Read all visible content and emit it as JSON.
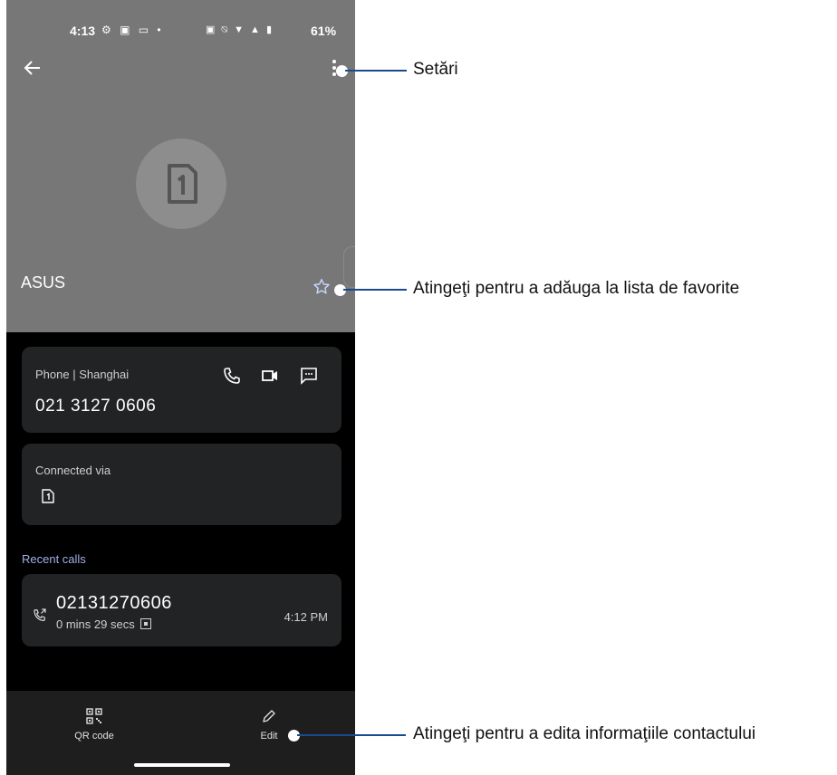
{
  "status_bar": {
    "time": "4:13",
    "left_icons": "⚙ ▣ ▭ •",
    "right_icons": "▣ ⍉ ▼ ▲ ▮",
    "battery": "61%"
  },
  "contact": {
    "name": "ASUS",
    "avatar_icon": "sim-card-1-icon"
  },
  "phone_card": {
    "label": "Phone | Shanghai",
    "number": "021 3127 0606",
    "actions": [
      "call-icon",
      "video-call-icon",
      "message-icon"
    ]
  },
  "connected_card": {
    "label": "Connected via",
    "icon": "sim-card-1-icon"
  },
  "recent": {
    "title": "Recent calls",
    "number": "02131270606",
    "duration": "0 mins 29 secs",
    "time": "4:12 PM"
  },
  "bottom_bar": {
    "qr_label": "QR code",
    "edit_label": "Edit"
  },
  "callouts": {
    "settings": "Setări",
    "favorites": "Atingeţi pentru a adăuga la lista de favorite",
    "edit": "Atingeţi pentru a edita informaţiile contactului"
  },
  "colors": {
    "header": "#777777",
    "background": "#000000",
    "card": "#222325",
    "accent_link": "#9fb0e6",
    "callout_line": "#1a4a8f"
  }
}
